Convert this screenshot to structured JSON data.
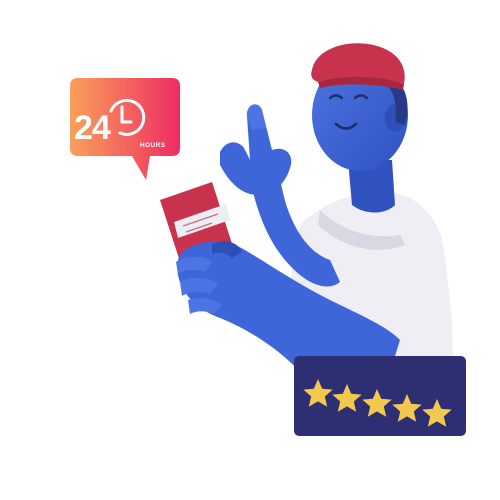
{
  "badge": {
    "number": "24",
    "unit": "HOURS"
  },
  "rating": {
    "value": 5,
    "max": 5
  },
  "colors": {
    "bubble_gradient_start": "#f9a05a",
    "bubble_gradient_end": "#ee2c63",
    "skin": "#3f66d8",
    "skin_shadow": "#2d4fb8",
    "cap": "#c8324c",
    "shirt": "#eeeef4",
    "phone": "#c8324c",
    "rating_panel": "#2d2f72",
    "star": "#f2c94c"
  },
  "icons": {
    "badge_icon": "clock-icon",
    "rating_icon": "star-icon"
  }
}
